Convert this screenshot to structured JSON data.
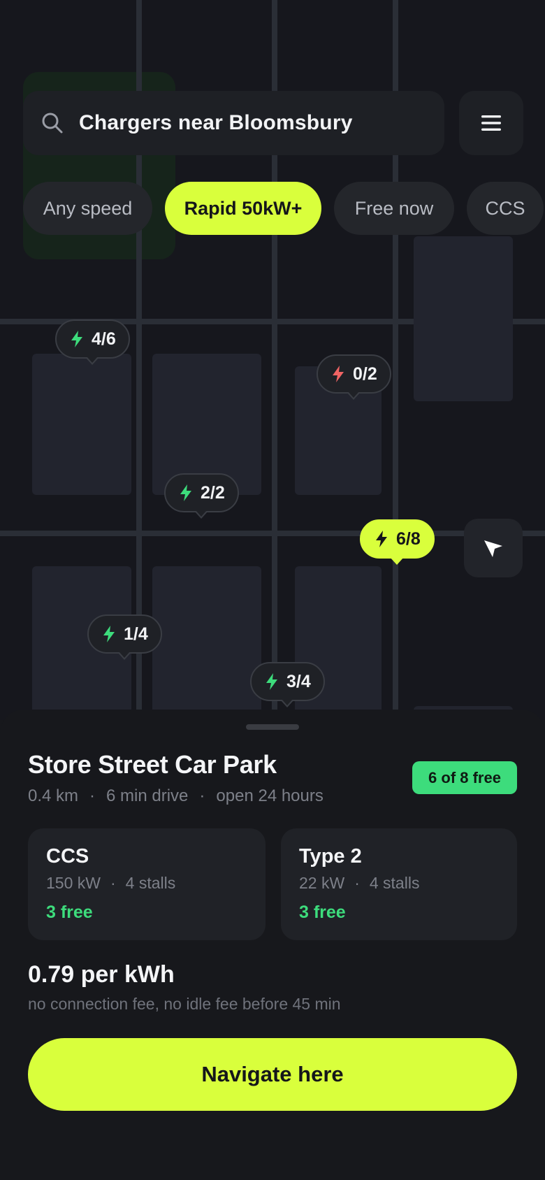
{
  "search": {
    "query": "Chargers near Bloomsbury"
  },
  "filters": [
    {
      "label": "Any speed",
      "active": false
    },
    {
      "label": "Rapid 50kW+",
      "active": true
    },
    {
      "label": "Free now",
      "active": false
    },
    {
      "label": "CCS",
      "active": false
    }
  ],
  "pins": [
    {
      "label": "4/6",
      "status": "available"
    },
    {
      "label": "0/2",
      "status": "full"
    },
    {
      "label": "2/2",
      "status": "available"
    },
    {
      "label": "6/8",
      "status": "selected"
    },
    {
      "label": "1/4",
      "status": "available"
    },
    {
      "label": "3/4",
      "status": "available"
    }
  ],
  "station": {
    "name": "Store Street Car Park",
    "free_badge": "6 of 8 free",
    "distance": "0.4 km",
    "drive": "6 min drive",
    "hours": "open 24 hours",
    "connectors": [
      {
        "type": "CCS",
        "power": "150 kW",
        "stalls": "4 stalls",
        "free": "3 free"
      },
      {
        "type": "Type 2",
        "power": "22 kW",
        "stalls": "4 stalls",
        "free": "3 free"
      }
    ],
    "price": "0.79 per kWh",
    "price_note": "no connection fee, no idle fee before 45 min",
    "navigate_label": "Navigate here"
  },
  "colors": {
    "accent": "#d9ff3c",
    "available": "#3ddc7c",
    "full": "#f06464",
    "surface": "#1e2025"
  }
}
